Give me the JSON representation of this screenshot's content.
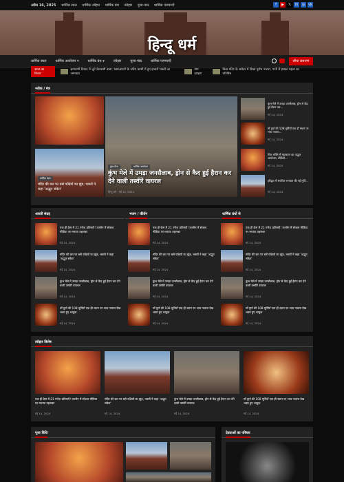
{
  "topbar": {
    "date": "अप्रैल 16, 2025",
    "links": [
      "धार्मिक स्थल",
      "धार्मिक त्योहार",
      "धार्मिक ग्रंथ",
      "त्योहार",
      "पूजा-पाठ",
      "धार्मिक परम्पराएँ"
    ]
  },
  "social": [
    "f",
    "▶",
    "𝕏",
    "in",
    "◎",
    "vk"
  ],
  "banner": {
    "title": "हिन्दू धर्म"
  },
  "nav": {
    "items": [
      "धार्मिक स्थल",
      "धार्मिक आयोजन ▾",
      "धार्मिक ग्रंथ ▾",
      "त्योहार",
      "पूजा-पाठ",
      "धार्मिक परम्पराएँ"
    ],
    "live": "सीधा प्रसारण"
  },
  "ticker": {
    "label": "आज का विचार",
    "items": [
      "ज्ञानवापी विवाद में जुटे देशवासी बाबा, भस्मआरती के जरिए काशी में हुए हजारों भक्तों का जमावड़ा",
      "गंगा दशहरा",
      "किस मंदिर के सरोवर में दिखा दुर्लभ नजारा, पानी में इसका महत्व का प्रतिबिंब"
    ]
  },
  "shlok": {
    "title": "श्लोक / मंत्र",
    "main": {
      "cat1": "कुंभ मेला",
      "cat2": "धार्मिक आयोजन",
      "title": "कुंभ मेले में उमड़ा जनसैलाब, ड्रोन से कैद हुई हैरान कर देने वाली तस्वीरें वायरल",
      "author": "हिन्दू धर्म",
      "date": "मई 14, 2024"
    },
    "left2": {
      "cat": "धार्मिक स्थल",
      "title": "मंदिर की छत पर बसे पक्षियों का झुंड, भक्तों ने कहा 'अद्भुत संकेत'",
      "date": "मई 14, 2024"
    },
    "side": [
      {
        "t": "कुंभ मेले में उमड़ा जनसैलाब, ड्रोन से कैद हुई हैरान कर...",
        "d": "मई 14, 2024"
      },
      {
        "t": "माँ दुर्गा की 108 मूर्तियाँ एक ही स्थान पर भव्य नजारा...",
        "d": "मई 14, 2024"
      },
      {
        "t": "शिव भक्ति में महाकाल का अद्भुत आयोजन, वीडियो...",
        "d": "मई 14, 2024"
      },
      {
        "t": "हरिद्वार में स्थापित भगवान की नई मूर्ति...",
        "d": "मई 14, 2024"
      }
    ]
  },
  "col1": {
    "title": "आरती संग्रह"
  },
  "col2": {
    "title": "भजन / कीर्तन"
  },
  "col3": {
    "title": "धार्मिक ग्रंथों से"
  },
  "list": [
    {
      "t": "एक ही क्रेम में 21 गणेश प्रतिमाएँ! उज्जैन में सोशल मीडिया पर मचाया तहलका",
      "d": "मई 14, 2024"
    },
    {
      "t": "मंदिर की छत पर बसे पक्षियों का झुंड, भक्तों ने कहा 'अद्भुत संकेत'",
      "d": "मई 14, 2024"
    },
    {
      "t": "कुंभ मेले में उमड़ा जनसैलाब, ड्रोन से कैद हुई हैरान कर देने वाली तस्वीरें वायरल",
      "d": "मई 14, 2024"
    },
    {
      "t": "माँ दुर्गा की 108 मूर्तियाँ एक ही स्थान पर भव्य नजारा देख भक्त हुए भावुक",
      "d": "मई 14, 2024"
    }
  ],
  "festival": {
    "title": "त्योहार विशेष",
    "cards": [
      {
        "t": "एक ही क्रेम में 21 गणेश प्रतिमाएँ! उज्जैन में सोशल मीडिया पर मचाया तहलका",
        "d": "मई 14, 2024"
      },
      {
        "t": "मंदिर की छत पर बसे पक्षियों का झुंड, भक्तों ने कहा 'अद्भुत संकेत'",
        "d": "मई 14, 2024"
      },
      {
        "t": "कुंभ मेले में उमड़ा जनसैलाब, ड्रोन से कैद हुई हैरान कर देने वाली तस्वीरें वायरल",
        "d": "मई 14, 2024"
      },
      {
        "t": "माँ दुर्गा की 108 मूर्तियाँ एक ही स्थान पर भव्य नजारा देख भक्त हुए भावुक",
        "d": "मई 14, 2024"
      }
    ]
  },
  "puja": {
    "title": "पूजा विधि"
  },
  "devta": {
    "title": "देवताओं का परिचय"
  }
}
